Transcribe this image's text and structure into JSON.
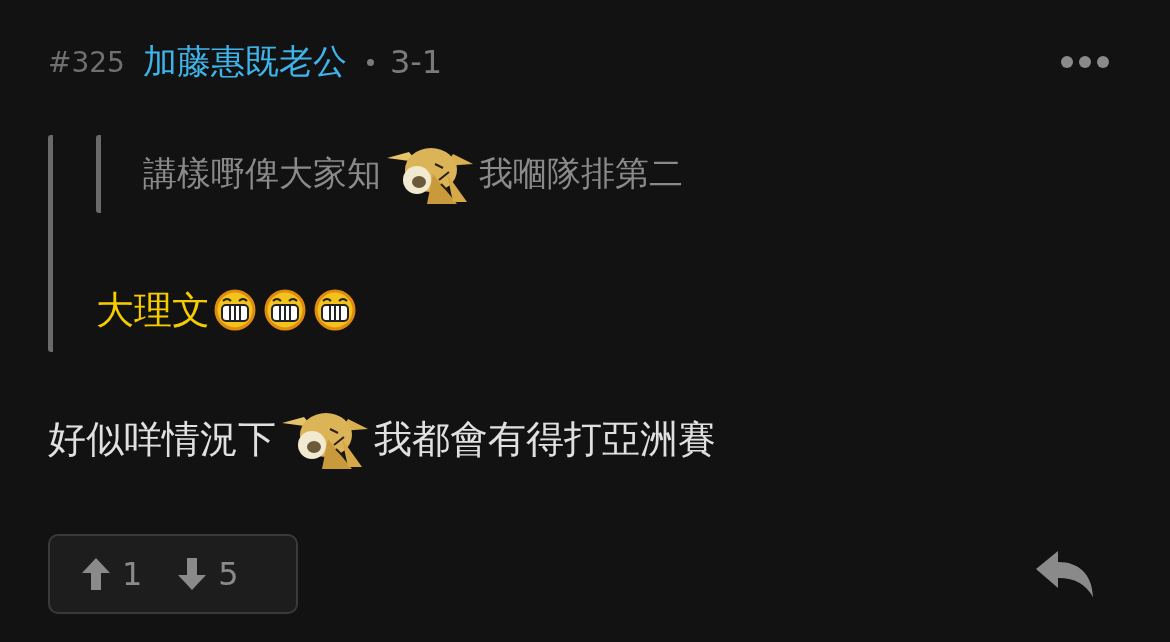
{
  "post": {
    "floor": "#325",
    "username": "加藤惠既老公",
    "time": "3-1"
  },
  "quote": {
    "nested_quote": [
      {
        "kind": "text",
        "text": "講樣嘢俾大家知"
      },
      {
        "kind": "dog_emoji"
      },
      {
        "kind": "text",
        "text": "我嗰隊排第二"
      }
    ],
    "content": [
      {
        "kind": "highlight",
        "text": "大理文"
      },
      {
        "kind": "grin_emoji"
      },
      {
        "kind": "grin_emoji"
      },
      {
        "kind": "grin_emoji"
      }
    ]
  },
  "body": [
    {
      "kind": "text",
      "text": "好似咩情況下"
    },
    {
      "kind": "dog_emoji"
    },
    {
      "kind": "text",
      "text": "我都會有得打亞洲賽"
    }
  ],
  "votes": {
    "up": "1",
    "down": "5"
  }
}
